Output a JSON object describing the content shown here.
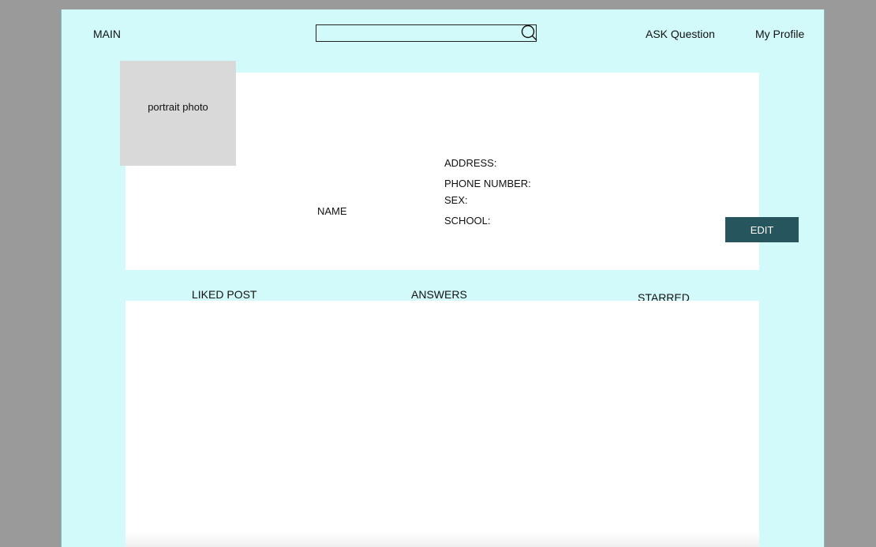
{
  "nav": {
    "main": "MAIN",
    "search_value": "",
    "ask_question": "ASK Question",
    "my_profile": "My Profile"
  },
  "profile": {
    "portrait": "portrait photo",
    "name": "NAME",
    "address_label": "ADDRESS:",
    "phone_label": "PHONE NUMBER:",
    "sex_label": "SEX:",
    "school_label": "SCHOOL:",
    "edit_label": "EDIT"
  },
  "tabs": [
    {
      "label": "LIKED POST"
    },
    {
      "label": "ANSWERS"
    },
    {
      "label": "STARRED"
    }
  ],
  "colors": {
    "page_background": "#d3fafa",
    "outer_background": "#9a9a9a",
    "card_background": "#ffffff",
    "portrait_placeholder": "#d9d9d9",
    "edit_button": "#26555e"
  },
  "icons": {
    "search": "search-icon"
  }
}
